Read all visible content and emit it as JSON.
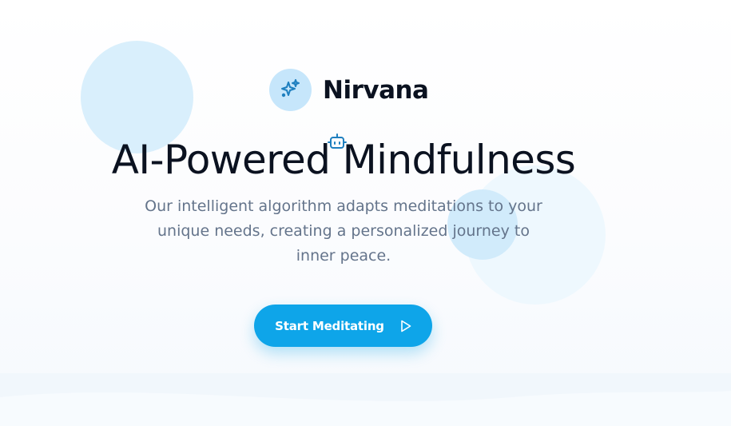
{
  "brand": {
    "name": "Nirvana",
    "icon": "sparkles-icon"
  },
  "hero": {
    "headline": "AI-Powered Mindfulness",
    "headline_icon": "robot-icon",
    "description": "Our intelligent algorithm adapts meditations to your unique needs, creating a personalized journey to inner peace."
  },
  "cta": {
    "label": "Start Meditating",
    "icon": "play-icon"
  },
  "colors": {
    "accent": "#0ea5e9",
    "heading": "#0b1220",
    "body_text": "#64748b",
    "bubble": "#d9effc"
  }
}
